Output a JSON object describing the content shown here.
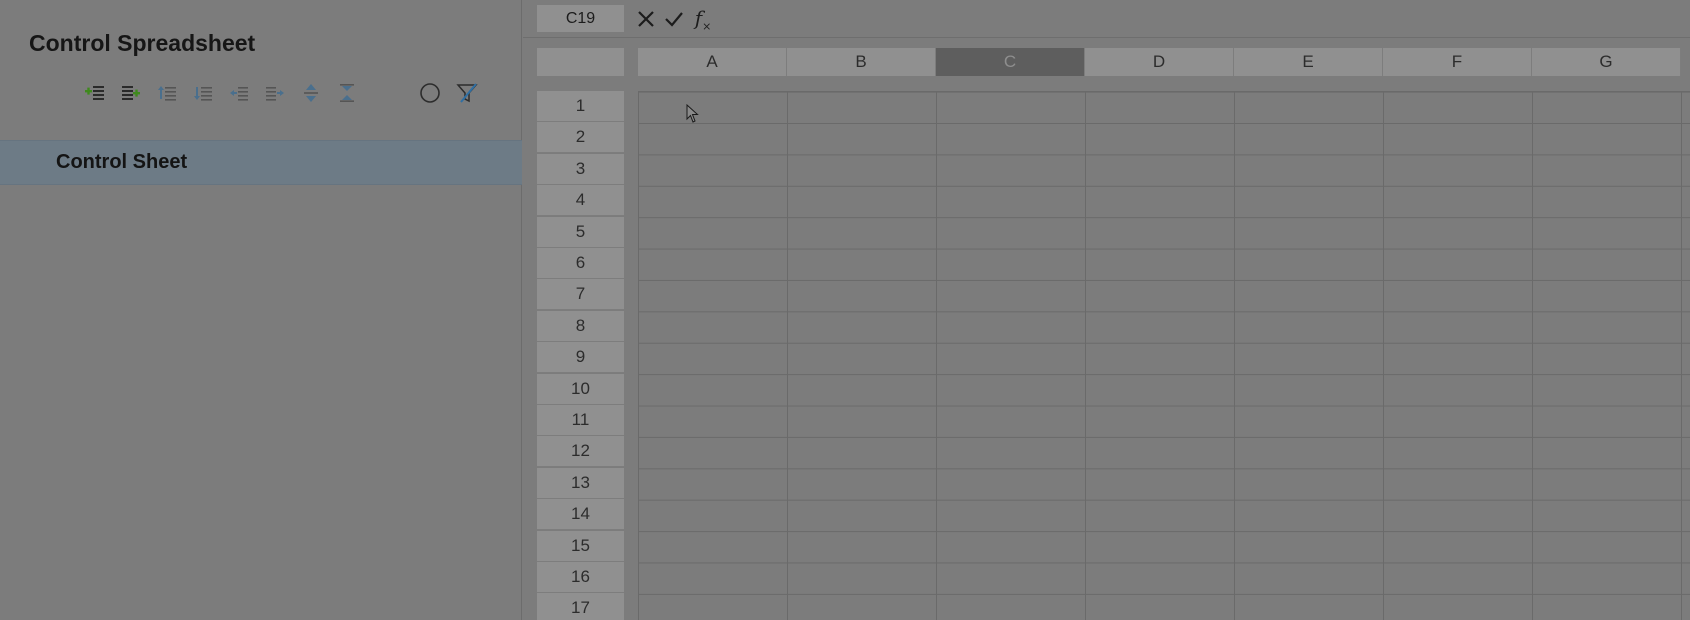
{
  "panel": {
    "title": "Control Spreadsheet",
    "toolbar": [
      {
        "name": "add-row-above-icon"
      },
      {
        "name": "add-row-below-icon"
      },
      {
        "name": "move-row-up-icon"
      },
      {
        "name": "move-row-down-icon"
      },
      {
        "name": "outdent-icon"
      },
      {
        "name": "indent-icon"
      },
      {
        "name": "expand-all-icon"
      },
      {
        "name": "collapse-all-icon"
      },
      {
        "name": "circle-icon"
      },
      {
        "name": "clear-filter-icon"
      }
    ],
    "sheets": [
      {
        "label": "Control Sheet",
        "selected": true
      }
    ]
  },
  "formula_bar": {
    "cell_ref": "C19",
    "cancel_icon": "close-icon",
    "confirm_icon": "check-icon",
    "function_label": "fx",
    "formula": ""
  },
  "grid": {
    "columns": [
      "A",
      "B",
      "C",
      "D",
      "E",
      "F",
      "G"
    ],
    "selected_column": "C",
    "rows": [
      "1",
      "2",
      "3",
      "4",
      "5",
      "6",
      "7",
      "8",
      "9",
      "10",
      "11",
      "12",
      "13",
      "14",
      "15",
      "16",
      "17"
    ]
  },
  "colors": {
    "overlay_background": "#7c7c7c",
    "selected_sheet": "#6d7b86",
    "selected_column_header": "#5e5e5e",
    "green_icon": "#3f8a1d",
    "blue_icon": "#4a6f8d"
  }
}
